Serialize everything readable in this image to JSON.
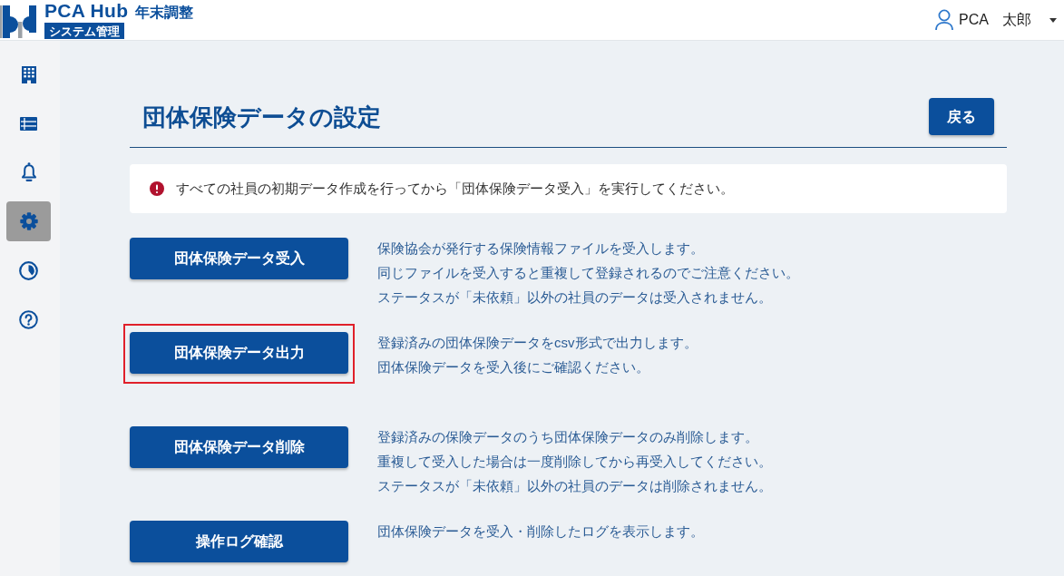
{
  "header": {
    "logo": {
      "product": "PCA Hub",
      "module": "年末調整",
      "badge": "システム管理"
    },
    "user": {
      "name": "PCA　太郎"
    }
  },
  "sidebar": {
    "items": [
      {
        "selected": false
      },
      {
        "selected": false
      },
      {
        "selected": false
      },
      {
        "selected": true
      },
      {
        "selected": false
      },
      {
        "selected": false
      }
    ]
  },
  "page": {
    "title": "団体保険データの設定",
    "back_button": "戻る",
    "alert": {
      "text": "すべての社員の初期データ作成を行ってから「団体保険データ受入」を実行してください。"
    },
    "actions": [
      {
        "label": "団体保険データ受入",
        "highlighted": false,
        "description": [
          "保険協会が発行する保険情報ファイルを受入します。",
          "同じファイルを受入すると重複して登録されるのでご注意ください。",
          "ステータスが「未依頼」以外の社員のデータは受入されません。"
        ]
      },
      {
        "label": "団体保険データ出力",
        "highlighted": true,
        "description": [
          "登録済みの団体保険データをcsv形式で出力します。",
          "団体保険データを受入後にご確認ください。"
        ]
      },
      {
        "label": "団体保険データ削除",
        "highlighted": false,
        "description": [
          "登録済みの保険データのうち団体保険データのみ削除します。",
          "重複して受入した場合は一度削除してから再受入してください。",
          "ステータスが「未依頼」以外の社員のデータは削除されません。"
        ]
      },
      {
        "label": "操作ログ確認",
        "highlighted": false,
        "description": [
          "団体保険データを受入・削除したログを表示します。"
        ]
      }
    ]
  }
}
